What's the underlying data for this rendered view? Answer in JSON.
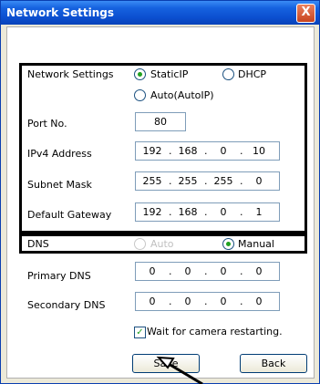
{
  "window": {
    "title": "Network Settings",
    "close_glyph": "X"
  },
  "network": {
    "label": "Network Settings",
    "options": [
      "StaticIP",
      "DHCP",
      "Auto(AutoIP)"
    ],
    "selected": "StaticIP"
  },
  "port": {
    "label": "Port No.",
    "value": "80"
  },
  "ipv4": {
    "label": "IPv4 Address",
    "octets": [
      "192",
      "168",
      "0",
      "10"
    ]
  },
  "subnet": {
    "label": "Subnet Mask",
    "octets": [
      "255",
      "255",
      "255",
      "0"
    ]
  },
  "gateway": {
    "label": "Default Gateway",
    "octets": [
      "192",
      "168",
      "0",
      "1"
    ]
  },
  "dns": {
    "label": "DNS",
    "options": [
      "Auto",
      "Manual"
    ],
    "selected": "Manual"
  },
  "primary_dns": {
    "label": "Primary DNS",
    "octets": [
      "0",
      "0",
      "0",
      "0"
    ]
  },
  "secondary_dns": {
    "label": "Secondary DNS",
    "octets": [
      "0",
      "0",
      "0",
      "0"
    ]
  },
  "wait": {
    "label": "Wait for camera restarting.",
    "checked": true
  },
  "buttons": {
    "save": "Save",
    "back": "Back"
  },
  "colors": {
    "titlebar": "#0b4fd0",
    "radio_dot": "#21a121",
    "highlight_border": "#000000"
  }
}
